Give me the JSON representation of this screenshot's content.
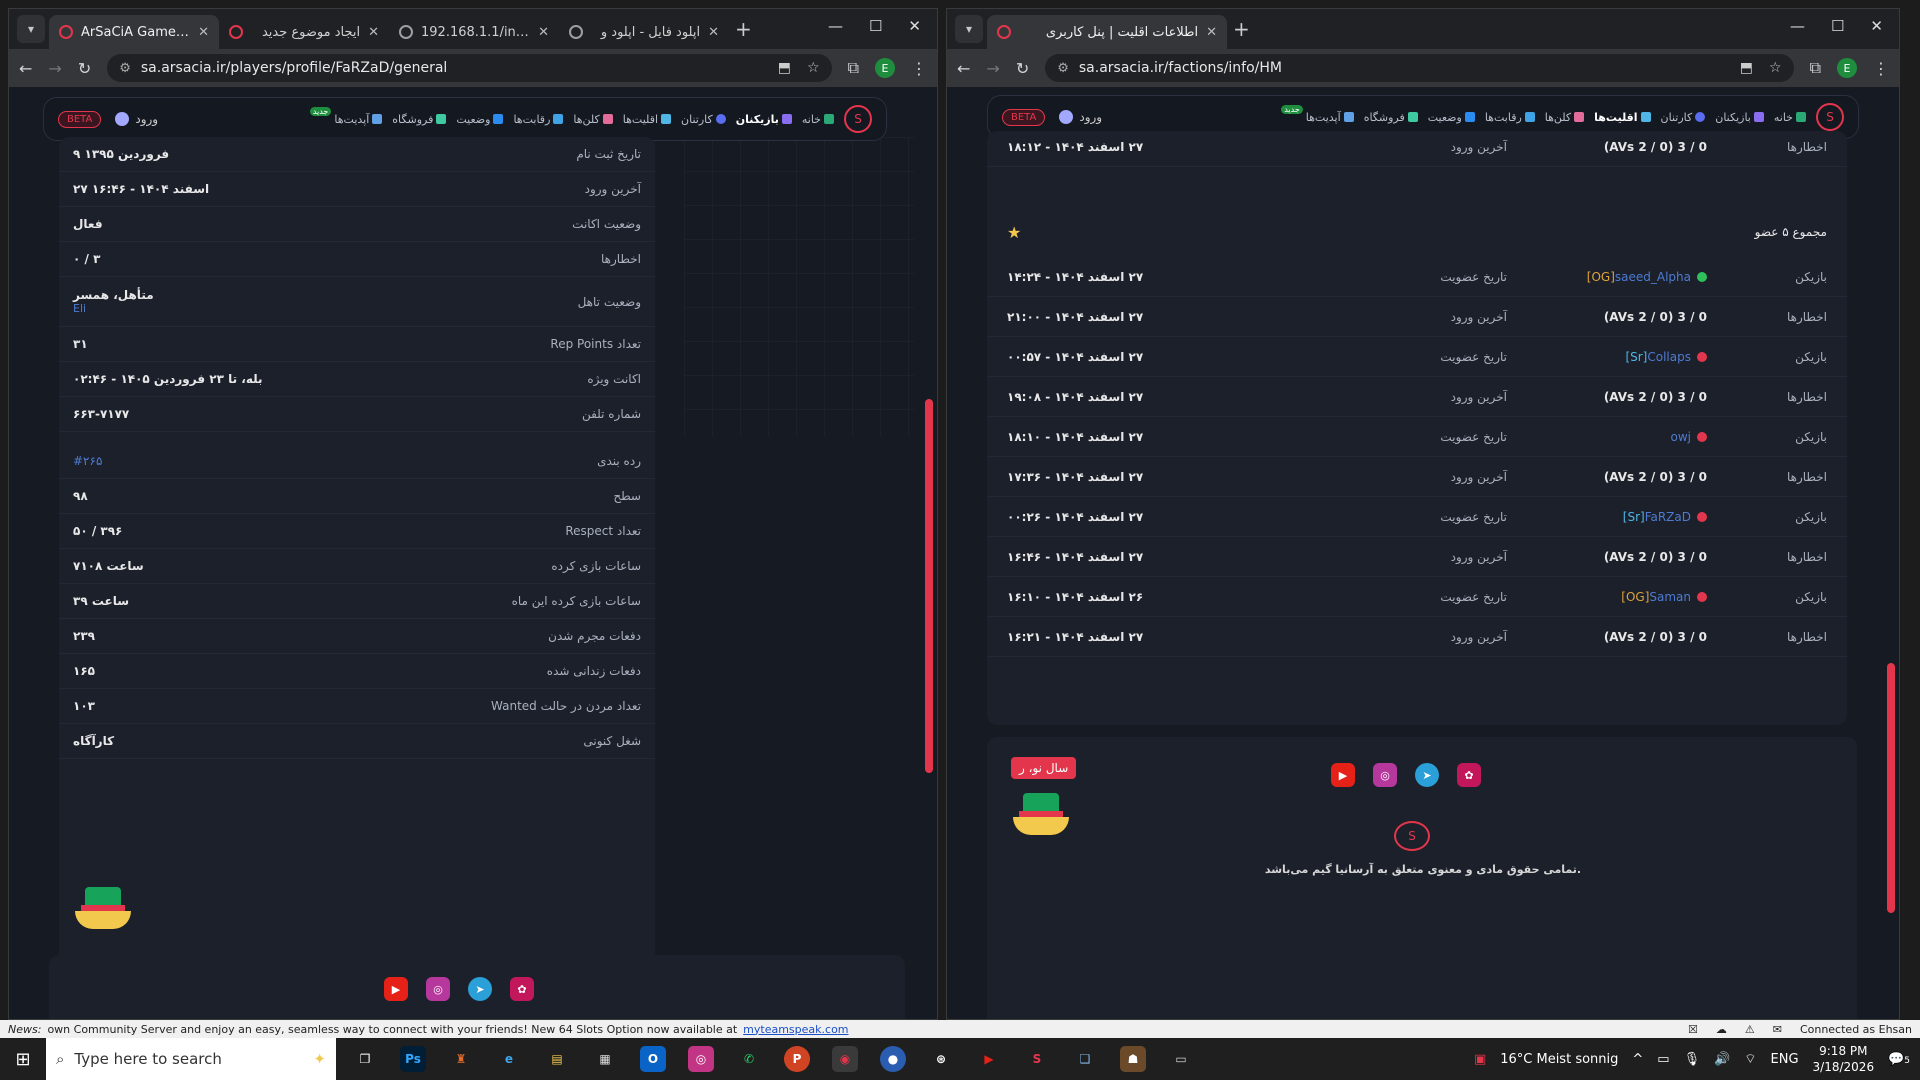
{
  "left_window": {
    "tabs": [
      {
        "title": "ArSaCiA Game - N",
        "active": true
      },
      {
        "title": "ایجاد موضوع جدید",
        "active": false
      },
      {
        "title": "192.168.1.1/index",
        "active": false
      },
      {
        "title": "آپلود فایل - اپلود و",
        "active": false
      }
    ],
    "url": "sa.arsacia.ir/players/profile/FaRZaD/general",
    "profile_letter": "E",
    "nav": {
      "items": [
        "خانه",
        "بازیکنان",
        "کارتنان",
        "اقلیت‌ها",
        "کلن‌ها",
        "رقابت‌ها",
        "وضعیت",
        "فروشگاه",
        "آپدیت‌ها"
      ],
      "new_badge": "جدید",
      "beta": "BETA",
      "login": "ورود"
    },
    "profile_rows": [
      {
        "label": "تاریخ ثبت نام",
        "value": "۹ فروردین ۱۳۹۵"
      },
      {
        "label": "آخرین ورود",
        "value": "۲۷ اسفند ۱۴۰۴ - ۱۶:۴۶"
      },
      {
        "label": "وضعیت اکانت",
        "value": "فعال"
      },
      {
        "label": "اخطارها",
        "value": "۰ / ۳"
      },
      {
        "label": "وضعیت تاهل",
        "value": "متأهل، همسر",
        "sub": "Eli"
      },
      {
        "label": "Rep Points تعداد",
        "value": "۳۱"
      },
      {
        "label": "اکانت ویژه",
        "value": "بله، تا ۲۳ فروردین ۱۴۰۵ - ۰۲:۴۶"
      },
      {
        "label": "شماره تلفن",
        "value": "۶۶۳-۷۱۷۷"
      }
    ],
    "stats_rows": [
      {
        "label": "رده بندی",
        "value": "#۲۶۵",
        "blue": true
      },
      {
        "label": "سطح",
        "value": "۹۸"
      },
      {
        "label": "Respect تعداد",
        "value": "۵۰ / ۳۹۶"
      },
      {
        "label": "ساعات بازی کرده",
        "value": "۷۱۰۸ ساعت"
      },
      {
        "label": "ساعات بازی کرده این ماه",
        "value": "۳۹ ساعت"
      },
      {
        "label": "دفعات مجرم شدن",
        "value": "۲۳۹"
      },
      {
        "label": "دفعات زندانی شده",
        "value": "۱۶۵"
      },
      {
        "label": "Wanted تعداد مردن در حالت",
        "value": "۱۰۳"
      },
      {
        "label": "شغل کنونی",
        "value": "کارآگاه"
      }
    ]
  },
  "right_window": {
    "tabs": [
      {
        "title": "اطلاعات اقلیت | پنل کاربری",
        "active": true
      }
    ],
    "url": "sa.arsacia.ir/factions/info/HM",
    "profile_letter": "E",
    "top_row": {
      "label": "اخطارها",
      "warnings": "0 / 3 (0 / 2 AVs)",
      "last_label": "آخرین ورود",
      "last": "۲۷ اسفند ۱۴۰۴ - ۱۸:۱۲"
    },
    "total_members": "مجموع ۵ عضو",
    "members": [
      {
        "tag": "[OG]",
        "tagType": "og",
        "name": "saeed_Alpha",
        "status": "green",
        "joined": "۲۷ اسفند ۱۴۰۴ - ۱۴:۲۴",
        "warnings": "0 / 3 (0 / 2 AVs)",
        "last": "۲۷ اسفند ۱۴۰۴ - ۲۱:۰۰"
      },
      {
        "tag": "[Sr]",
        "tagType": "sr",
        "name": "Collaps",
        "status": "red",
        "joined": "۲۷ اسفند ۱۴۰۴ - ۰۰:۵۷",
        "warnings": "0 / 3 (0 / 2 AVs)",
        "last": "۲۷ اسفند ۱۴۰۴ - ۱۹:۰۸"
      },
      {
        "tag": "",
        "tagType": "",
        "name": "owj",
        "status": "red",
        "joined": "۲۷ اسفند ۱۴۰۴ - ۱۸:۱۰",
        "warnings": "0 / 3 (0 / 2 AVs)",
        "last": "۲۷ اسفند ۱۴۰۴ - ۱۷:۳۶"
      },
      {
        "tag": "[Sr]",
        "tagType": "sr",
        "name": "FaRZaD",
        "status": "red",
        "joined": "۲۷ اسفند ۱۴۰۴ - ۰۰:۲۶",
        "warnings": "0 / 3 (0 / 2 AVs)",
        "last": "۲۷ اسفند ۱۴۰۴ - ۱۶:۴۶"
      },
      {
        "tag": "[OG]",
        "tagType": "og",
        "name": "Saman",
        "status": "red",
        "joined": "۲۶ اسفند ۱۴۰۴ - ۱۶:۱۰",
        "warnings": "0 / 3 (0 / 2 AVs)",
        "last": "۲۷ اسفند ۱۴۰۴ - ۱۶:۲۱"
      }
    ],
    "labels": {
      "player": "بازیکن",
      "joined": "تاریخ عضویت",
      "warnings": "اخطارها",
      "last": "آخرین ورود"
    },
    "nowruz": "سال نو، ر",
    "copyright": "تمامی حقوق مادی و معنوی متعلق به آرسانیا گیم می‌باشد."
  },
  "newsbar": {
    "label": "News:",
    "text": "own Community Server and enjoy an easy, seamless way to connect with your friends! New 64 Slots Option now available at",
    "link": "myteamspeak.com",
    "connected": "Connected as Ehsan"
  },
  "taskbar": {
    "search_placeholder": "Type here to search",
    "weather": "16°C  Meist sonnig",
    "lang": "ENG",
    "time": "9:18 PM",
    "date": "3/18/2026",
    "notif_count": "5"
  },
  "colors": {
    "accent": "#e3364c",
    "bg": "#161a23",
    "panel": "#1b202b"
  }
}
